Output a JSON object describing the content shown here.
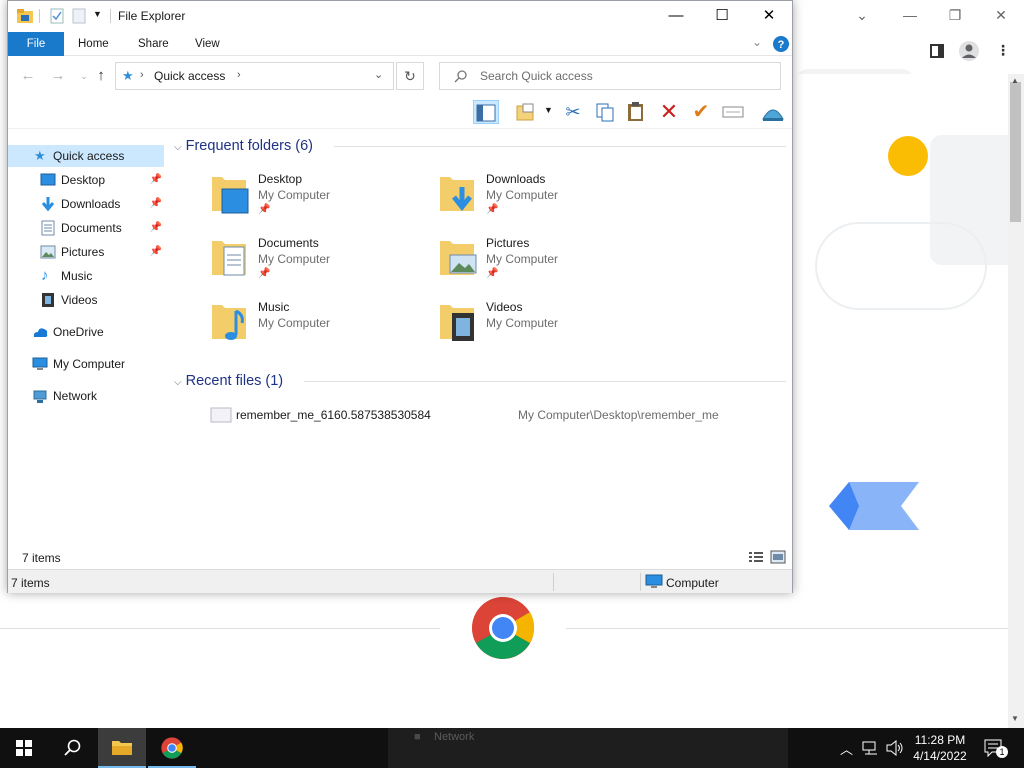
{
  "explorer": {
    "title": "File Explorer",
    "tabs": {
      "file": "File",
      "home": "Home",
      "share": "Share",
      "view": "View"
    },
    "address": {
      "location": "Quick access"
    },
    "search": {
      "placeholder": "Search Quick access"
    },
    "nav": {
      "quick_access": "Quick access",
      "desktop": "Desktop",
      "downloads": "Downloads",
      "documents": "Documents",
      "pictures": "Pictures",
      "music": "Music",
      "videos": "Videos",
      "onedrive": "OneDrive",
      "my_computer": "My Computer",
      "network": "Network"
    },
    "frequent": {
      "header": "Frequent folders (6)",
      "folders": [
        {
          "name": "Desktop",
          "location": "My Computer",
          "icon": "desktop-folder-icon"
        },
        {
          "name": "Downloads",
          "location": "My Computer",
          "icon": "downloads-folder-icon"
        },
        {
          "name": "Documents",
          "location": "My Computer",
          "icon": "documents-folder-icon"
        },
        {
          "name": "Pictures",
          "location": "My Computer",
          "icon": "pictures-folder-icon"
        },
        {
          "name": "Music",
          "location": "My Computer",
          "icon": "music-folder-icon"
        },
        {
          "name": "Videos",
          "location": "My Computer",
          "icon": "videos-folder-icon"
        }
      ]
    },
    "recent": {
      "header": "Recent files (1)",
      "files": [
        {
          "name": "remember_me_6160.587538530584",
          "path": "My Computer\\Desktop\\remember_me"
        }
      ]
    },
    "status": {
      "inner_count": "7 items",
      "count": "7 items",
      "zone": "Computer"
    }
  },
  "taskbar": {
    "ghost_label": "Network",
    "time": "11:28 PM",
    "date": "4/14/2022",
    "notification_count": "1"
  },
  "colors": {
    "ribbon_file_tab": "#1979ca",
    "selection": "#cce8ff",
    "group_header": "#1e3287",
    "taskbar": "#101010"
  }
}
